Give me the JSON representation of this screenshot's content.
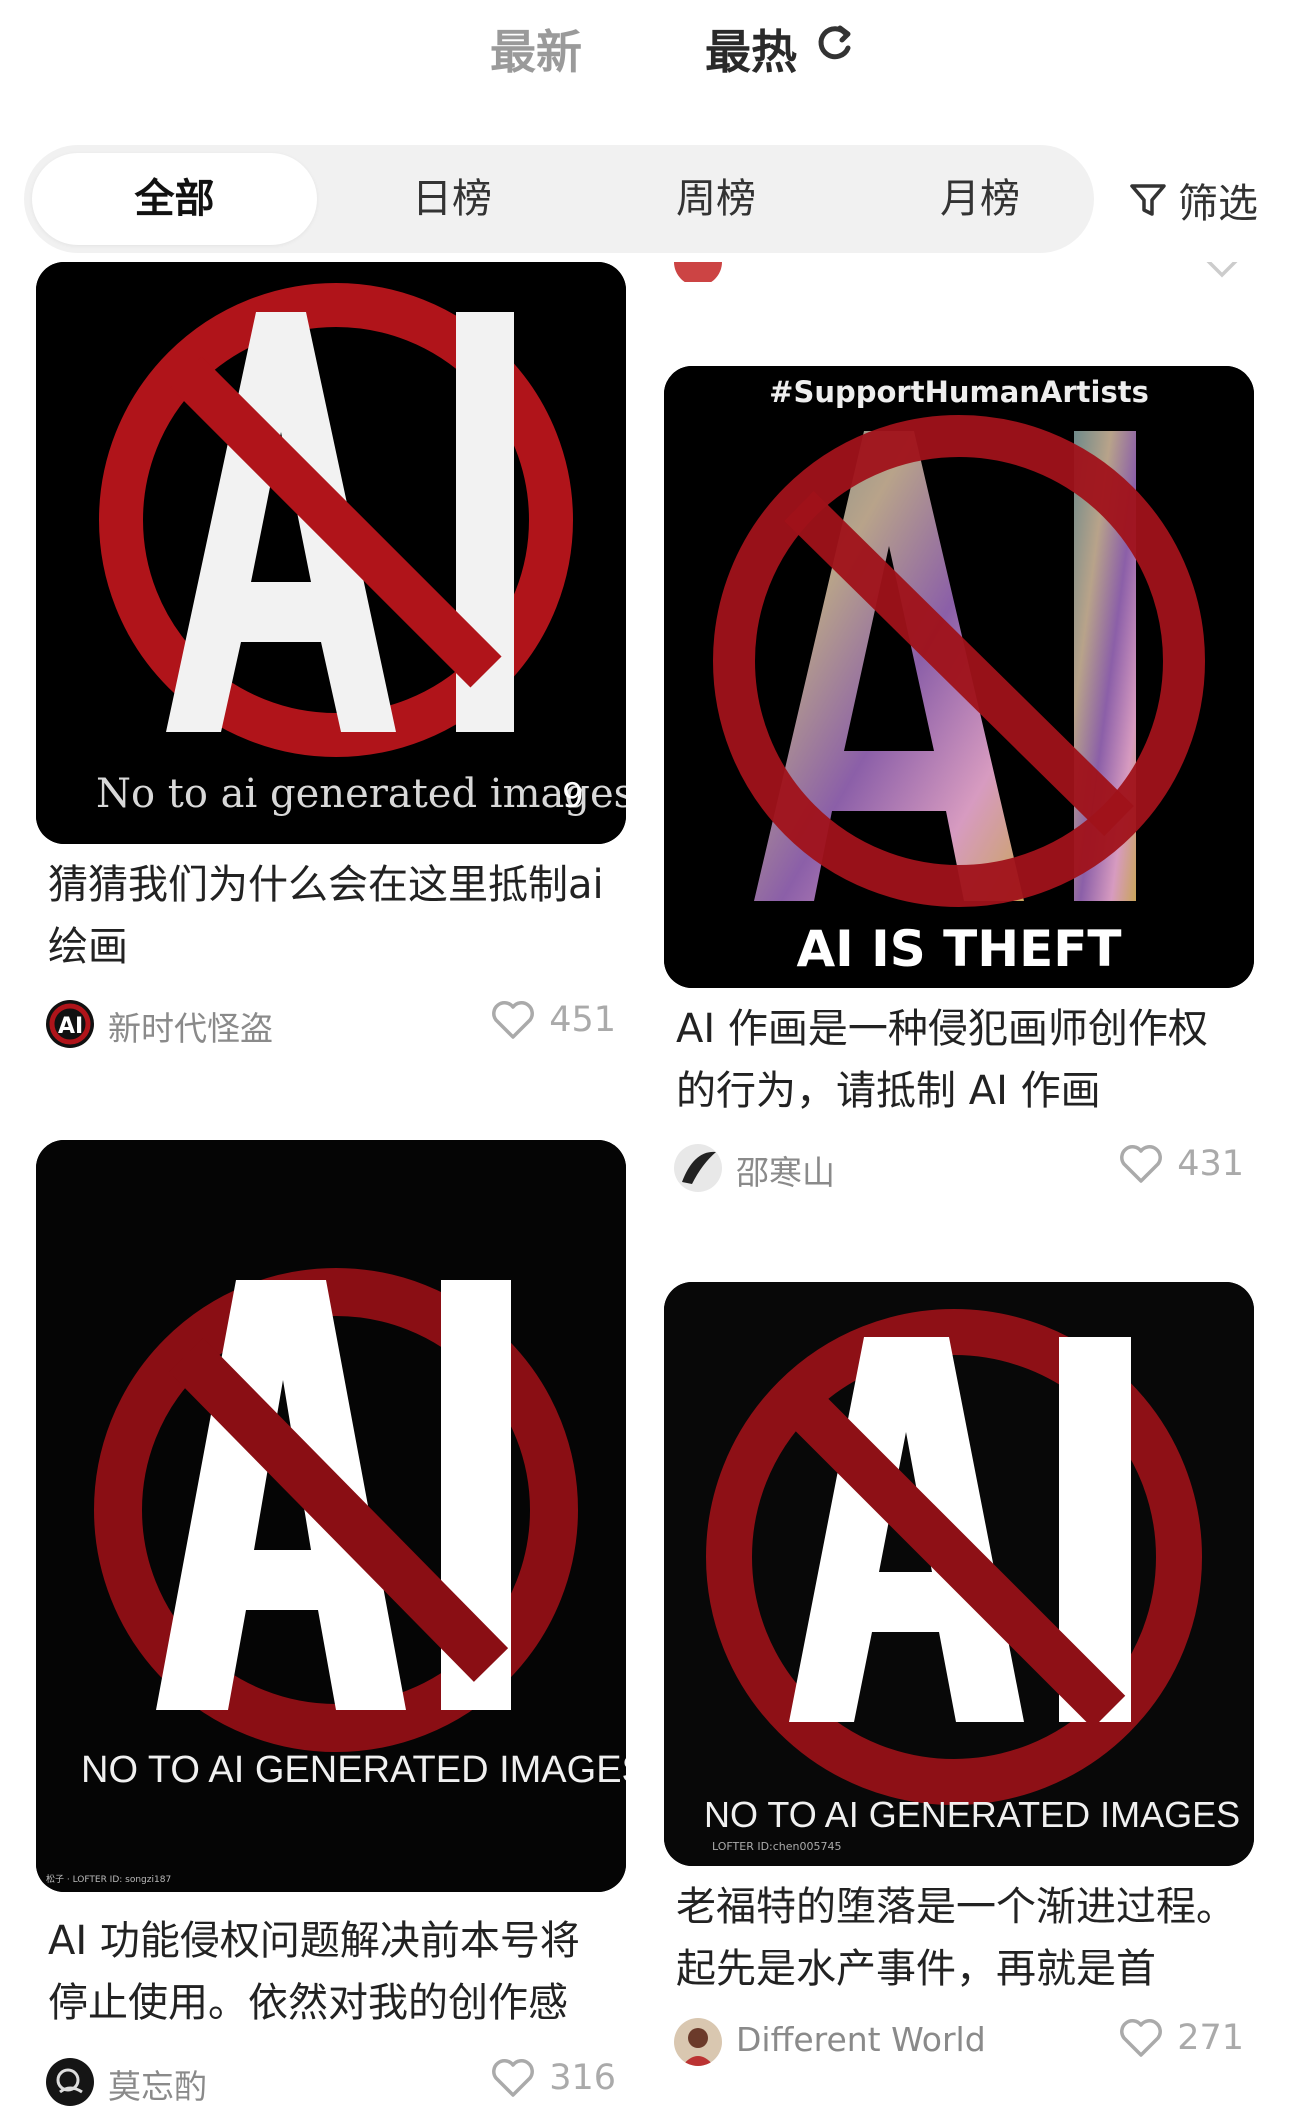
{
  "top_tabs": {
    "latest": "最新",
    "hot": "最热"
  },
  "segments": [
    "全部",
    "日榜",
    "周榜",
    "月榜"
  ],
  "filter_label": "筛选",
  "colors": {
    "like": "#aaaaaa",
    "ban_red": "#b0141a",
    "active_text": "#111111"
  },
  "posts": {
    "left": [
      {
        "image_caption": "No to ai generated images",
        "badge": "9",
        "title": "猜猜我们为什么会在这里抵制ai绘画",
        "author": "新时代怪盗",
        "likes": "451"
      },
      {
        "image_caption": "NO TO AI GENERATED IMAGES",
        "watermark": "松子 · LOFTER ID: songzi187",
        "title": "AI 功能侵权问题解决前本号将停止使用。依然对我的创作感",
        "author": "莫忘酌",
        "likes": "316"
      }
    ],
    "right": [
      {
        "hashtag": "#SupportHumanArtists",
        "image_caption": "AI IS THEFT",
        "title": "AI 作画是一种侵犯画师创作权的行为，请抵制 AI 作画",
        "author": "邵寒山",
        "likes": "431"
      },
      {
        "image_caption": "NO TO AI GENERATED IMAGES",
        "watermark": "LOFTER ID:chen005745",
        "title": "老福特的堕落是一个渐进过程。起先是水产事件，再就是首",
        "author": "Different World",
        "likes": "271"
      }
    ]
  }
}
